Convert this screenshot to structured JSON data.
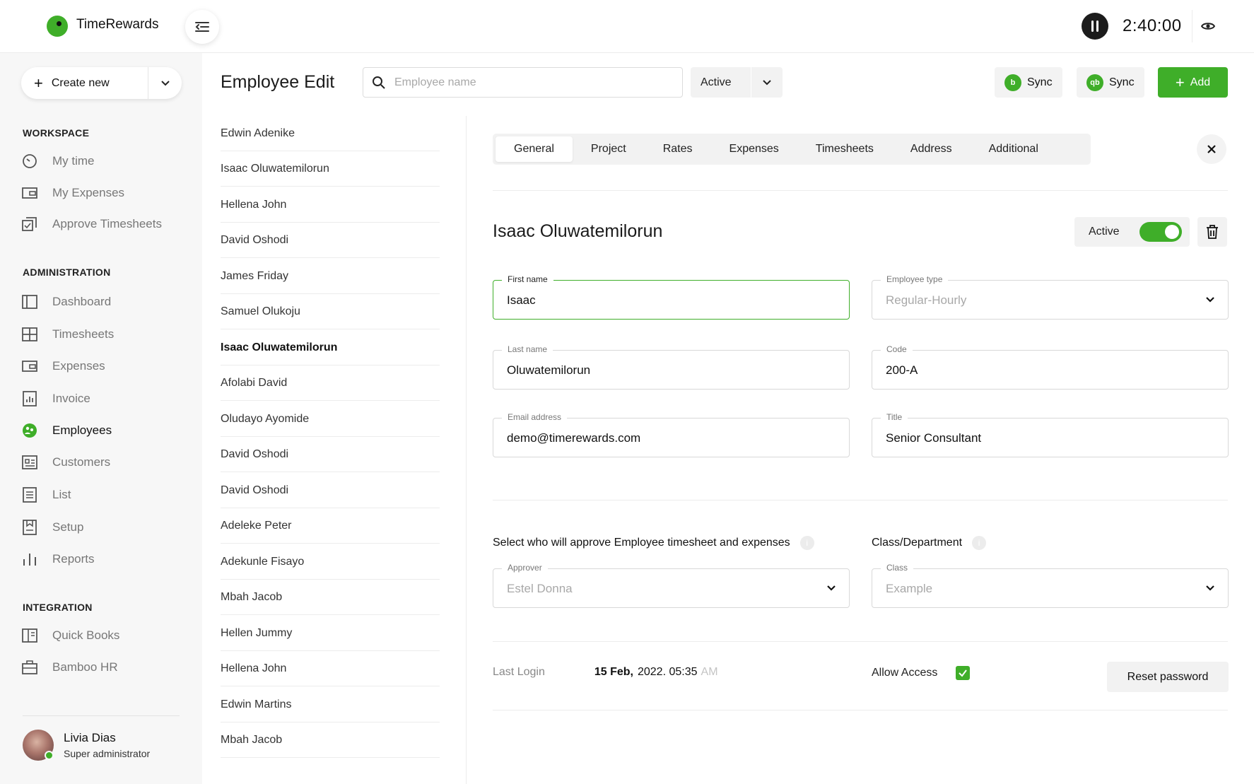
{
  "app": {
    "brand": "TimeRewards"
  },
  "timer": {
    "value": "2:40:00"
  },
  "sidebar": {
    "create_label": "Create new",
    "sections": {
      "workspace": "WORKSPACE",
      "administration": "ADMINISTRATION",
      "integration": "INTEGRATION"
    },
    "workspace_items": [
      {
        "label": "My time",
        "icon": "clock-icon"
      },
      {
        "label": "My Expenses",
        "icon": "wallet-icon"
      },
      {
        "label": "Approve Timesheets",
        "icon": "approve-icon"
      }
    ],
    "admin_items": [
      {
        "label": "Dashboard",
        "icon": "dashboard-icon"
      },
      {
        "label": "Timesheets",
        "icon": "grid-icon"
      },
      {
        "label": "Expenses",
        "icon": "wallet-icon"
      },
      {
        "label": "Invoice",
        "icon": "invoice-icon"
      },
      {
        "label": "Employees",
        "icon": "employees-icon",
        "active": true
      },
      {
        "label": "Customers",
        "icon": "customers-icon"
      },
      {
        "label": "List",
        "icon": "list-icon"
      },
      {
        "label": "Setup",
        "icon": "setup-icon"
      },
      {
        "label": "Reports",
        "icon": "reports-icon"
      }
    ],
    "integration_items": [
      {
        "label": "Quick Books",
        "icon": "book-icon"
      },
      {
        "label": "Bamboo HR",
        "icon": "briefcase-icon"
      }
    ],
    "user": {
      "name": "Livia Dias",
      "role": "Super administrator"
    }
  },
  "header": {
    "title": "Employee Edit",
    "search_placeholder": "Employee name",
    "status_value": "Active",
    "sync1_label": "Sync",
    "sync2_label": "Sync",
    "add_label": "Add"
  },
  "employees": [
    "Edwin Adenike",
    "Isaac Oluwatemilorun",
    "Hellena John",
    "David Oshodi",
    "James Friday",
    "Samuel Olukoju",
    "Isaac Oluwatemilorun",
    "Afolabi David",
    "Oludayo Ayomide",
    "David Oshodi",
    "David Oshodi",
    "Adeleke Peter",
    "Adekunle Fisayo",
    "Mbah Jacob",
    "Hellen Jummy",
    "Hellena John",
    "Edwin Martins",
    "Mbah Jacob"
  ],
  "selected_index": 6,
  "detail": {
    "tabs": [
      "General",
      "Project",
      "Rates",
      "Expenses",
      "Timesheets",
      "Address",
      "Additional"
    ],
    "active_tab": "General",
    "name": "Isaac Oluwatemilorun",
    "active_label": "Active",
    "fields": {
      "first_name": {
        "label": "First name",
        "value": "Isaac"
      },
      "employee_type": {
        "label": "Employee type",
        "value": "Regular-Hourly"
      },
      "last_name": {
        "label": "Last name",
        "value": "Oluwatemilorun"
      },
      "code": {
        "label": "Code",
        "value": "200-A"
      },
      "email": {
        "label": "Email address",
        "value": "demo@timerewards.com"
      },
      "title": {
        "label": "Title",
        "value": "Senior Consultant"
      }
    },
    "approver_question": "Select who will approve Employee timesheet and expenses",
    "class_question": "Class/Department",
    "approver": {
      "label": "Approver",
      "value": "Estel Donna"
    },
    "class": {
      "label": "Class",
      "value": "Example"
    },
    "last_login_label": "Last Login",
    "last_login_date": "15 Feb,",
    "last_login_time": "2022. 05:35",
    "last_login_ampm": "AM",
    "allow_access_label": "Allow Access",
    "reset_label": "Reset password"
  },
  "colors": {
    "accent": "#3fae29"
  }
}
